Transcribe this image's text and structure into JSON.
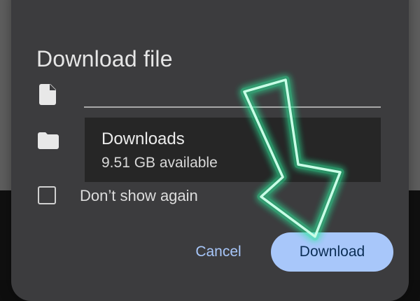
{
  "dialog": {
    "title": "Download file",
    "filename": {
      "value": "",
      "file_icon": "file-icon"
    },
    "location": {
      "folder_icon": "folder-icon",
      "name": "Downloads",
      "available": "9.51 GB available"
    },
    "dont_show_again": {
      "label": "Don’t show again",
      "checked": false
    },
    "buttons": {
      "cancel_label": "Cancel",
      "download_label": "Download"
    }
  },
  "overlay": {
    "icon": "arrow-down-right-icon",
    "color": "#2ee89a"
  },
  "colors": {
    "dialog_background": "#3c3c3e",
    "location_background": "#262626",
    "accent": "#a8c7fa",
    "accent_text": "#0b2e55"
  }
}
